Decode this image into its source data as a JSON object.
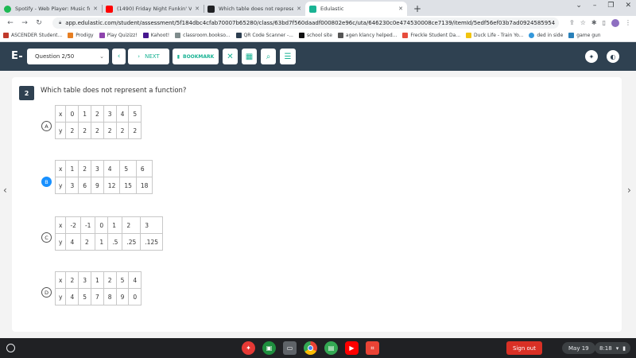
{
  "browser": {
    "tabs": [
      {
        "label": "Spotify - Web Player: Music for e",
        "color": "#1db954",
        "active": false
      },
      {
        "label": "(1490) Friday Night Funkin' VS",
        "color": "#ff0000",
        "active": false
      },
      {
        "label": "Which table does not represent",
        "color": "#202124",
        "active": false
      },
      {
        "label": "Edulastic",
        "color": "#1ab394",
        "active": true
      }
    ],
    "new_tab": "+",
    "url": "app.edulastic.com/student/assessment/5f184dbc4cfab70007b65280/class/63bd7f560daadf000802e96c/uta/646230c0e474530008ce7139/itemId/5edf56ef03b7ad0924585954",
    "bookmarks": [
      {
        "label": "ASCENDER Student...",
        "color": "#c0392b"
      },
      {
        "label": "Prodigy",
        "color": "#e67e22"
      },
      {
        "label": "Play Quizizz!",
        "color": "#8e44ad"
      },
      {
        "label": "Kahoot!",
        "color": "#46178f"
      },
      {
        "label": "classroom.bookso...",
        "color": "#7f8c8d"
      },
      {
        "label": "QR Code Scanner -...",
        "color": "#2c3e50"
      },
      {
        "label": "school site",
        "color": "#111111"
      },
      {
        "label": "agen klancy helped...",
        "color": "#555555"
      },
      {
        "label": "Freckle Student Da...",
        "color": "#e74c3c"
      },
      {
        "label": "Duck Life - Train Yo...",
        "color": "#f1c40f"
      },
      {
        "label": "ded in side",
        "color": "#3498db"
      },
      {
        "label": "game gun",
        "color": "#2980b9"
      }
    ]
  },
  "header": {
    "logo": "E",
    "question_select": "Question 2/50",
    "prev_icon": "‹",
    "next_label": "NEXT",
    "next_icon": "›",
    "bookmark_label": "BOOKMARK",
    "bookmark_icon": "▮",
    "tool_icons": [
      "✕",
      "▦",
      "⌕",
      "☰"
    ],
    "right_icons": [
      "✦",
      "◐"
    ]
  },
  "question": {
    "number": "2",
    "text": "Which table does not represent a function?",
    "options": [
      {
        "letter": "A",
        "selected": false,
        "x": [
          "0",
          "1",
          "2",
          "3",
          "4",
          "5"
        ],
        "y": [
          "2",
          "2",
          "2",
          "2",
          "2",
          "2"
        ]
      },
      {
        "letter": "B",
        "selected": true,
        "x": [
          "1",
          "2",
          "3",
          "4",
          "5",
          "6"
        ],
        "y": [
          "3",
          "6",
          "9",
          "12",
          "15",
          "18"
        ]
      },
      {
        "letter": "C",
        "selected": false,
        "x": [
          "-2",
          "-1",
          "0",
          "1",
          "2",
          "3"
        ],
        "y": [
          "4",
          "2",
          "1",
          ".5",
          ".25",
          ".125"
        ]
      },
      {
        "letter": "D",
        "selected": false,
        "x": [
          "2",
          "3",
          "1",
          "2",
          "5",
          "4"
        ],
        "y": [
          "4",
          "5",
          "7",
          "8",
          "9",
          "0"
        ]
      }
    ],
    "row_labels": {
      "x": "x",
      "y": "y"
    }
  },
  "nav": {
    "left": "‹",
    "right": "›"
  },
  "taskbar": {
    "sign_out": "Sign out",
    "date": "May 19",
    "time": "8:18",
    "apps": [
      {
        "name": "game",
        "color": "#e53935"
      },
      {
        "name": "classroom",
        "color": "#1e8e3e"
      },
      {
        "name": "files",
        "color": "#5f6368"
      },
      {
        "name": "chrome",
        "color": "#4285f4"
      },
      {
        "name": "classroom-2",
        "color": "#34a853"
      },
      {
        "name": "youtube",
        "color": "#ff0000"
      },
      {
        "name": "screenshot",
        "color": "#ea4335"
      }
    ]
  }
}
